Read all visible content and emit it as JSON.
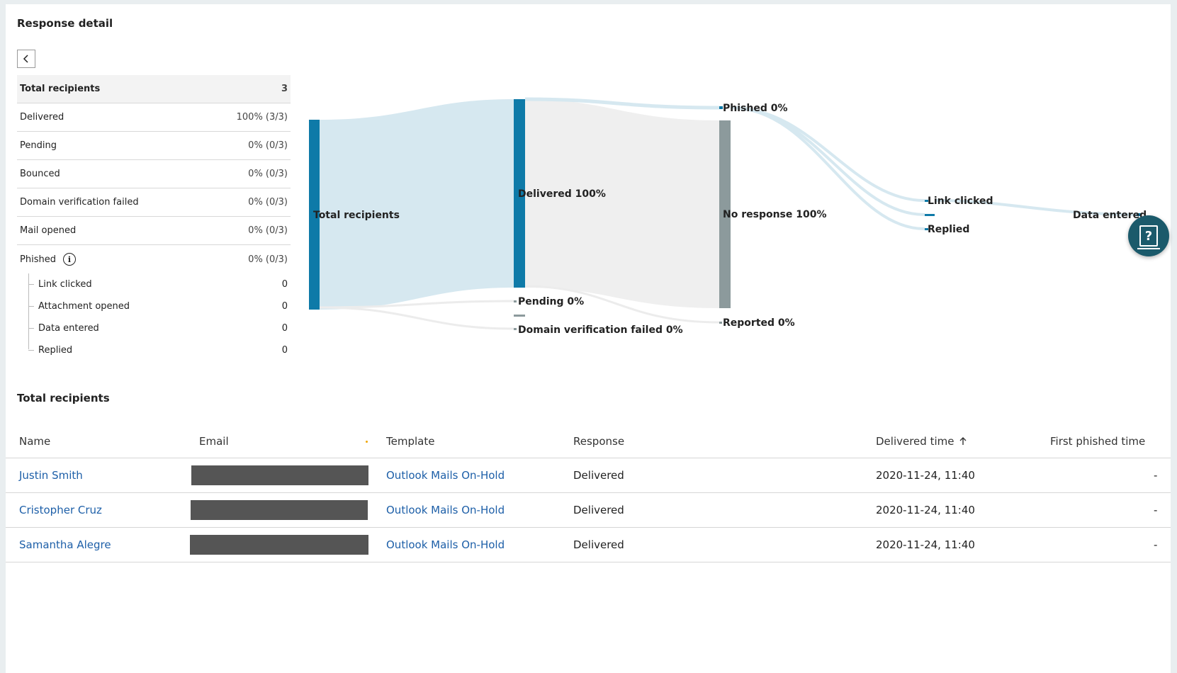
{
  "page": {
    "title": "Response detail"
  },
  "back_icon": "chevron-left-icon",
  "summary": {
    "header": {
      "label": "Total recipients",
      "value": "3"
    },
    "rows": [
      {
        "label": "Delivered",
        "value": "100% (3/3)"
      },
      {
        "label": "Pending",
        "value": "0% (0/3)"
      },
      {
        "label": "Bounced",
        "value": "0% (0/3)"
      },
      {
        "label": "Domain verification failed",
        "value": "0% (0/3)"
      },
      {
        "label": "Mail opened",
        "value": "0% (0/3)"
      }
    ],
    "phished": {
      "label": "Phished",
      "value": "0% (0/3)",
      "icon": "info-icon"
    },
    "phished_sub": [
      {
        "label": "Link clicked",
        "value": "0"
      },
      {
        "label": "Attachment opened",
        "value": "0"
      },
      {
        "label": "Data entered",
        "value": "0"
      },
      {
        "label": "Replied",
        "value": "0"
      }
    ]
  },
  "sankey": {
    "labels": {
      "total": "Total recipients",
      "delivered": "Delivered 100%",
      "pending": "Pending 0%",
      "domain_failed": "Domain verification failed 0%",
      "phished": "Phished 0%",
      "no_response": "No response 100%",
      "reported": "Reported 0%",
      "link_clicked": "Link clicked",
      "replied": "Replied",
      "data_entered": "Data entered"
    },
    "colors": {
      "primary": "#0e7aa8",
      "gray": "#8c9a9c",
      "flow_blue": "#d6e8f0",
      "flow_gray": "#efefef"
    }
  },
  "recipients": {
    "title": "Total recipients",
    "columns": {
      "name": "Name",
      "email": "Email",
      "template": "Template",
      "response": "Response",
      "delivered_time": "Delivered time",
      "first_phished": "First phished time"
    },
    "rows": [
      {
        "name": "Justin Smith",
        "template": "Outlook Mails On-Hold",
        "response": "Delivered",
        "delivered_time": "2020-11-24, 11:40",
        "first_phished": "-"
      },
      {
        "name": "Cristopher Cruz",
        "template": "Outlook Mails On-Hold",
        "response": "Delivered",
        "delivered_time": "2020-11-24, 11:40",
        "first_phished": "-"
      },
      {
        "name": "Samantha Alegre",
        "template": "Outlook Mails On-Hold",
        "response": "Delivered",
        "delivered_time": "2020-11-24, 11:40",
        "first_phished": "-"
      }
    ]
  },
  "help_icon": "help-book-icon"
}
